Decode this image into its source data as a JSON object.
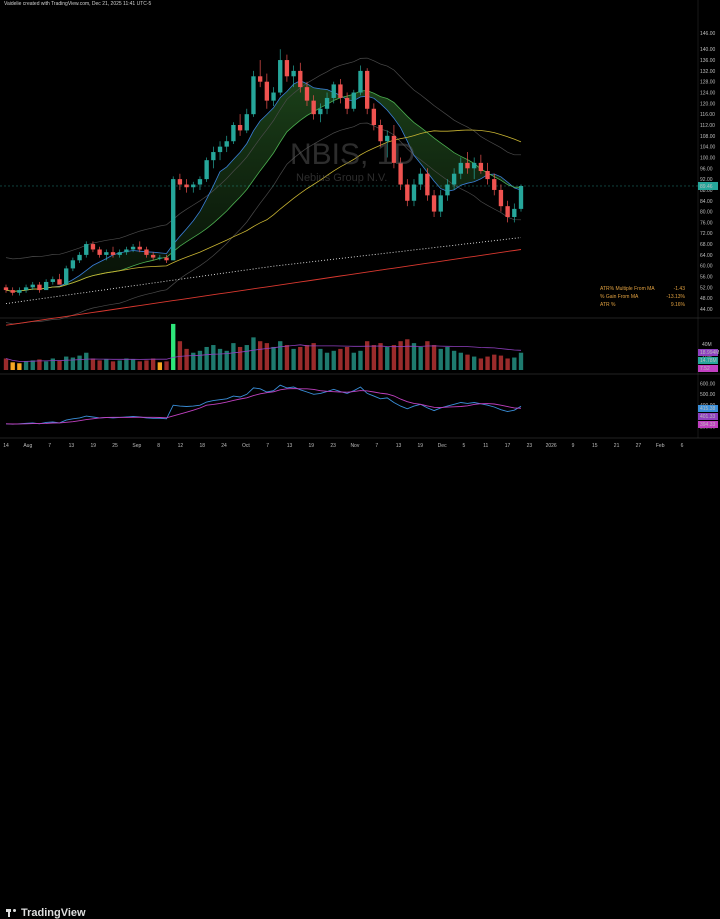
{
  "header": {
    "text": "Vaidelie created with TradingView.com, Dec 21, 2025 11:41 UTC-5"
  },
  "watermark": {
    "symbol": "NBIS, 1D",
    "name": "Nebius Group N.V."
  },
  "footer": {
    "logo_text": "TradingView"
  },
  "atr_table": [
    {
      "label": "ATR% Multiple From MA",
      "value": "-1.43"
    },
    {
      "label": "% Gain From MA",
      "value": "-13.13%"
    },
    {
      "label": "ATR %",
      "value": "9.16%"
    }
  ],
  "price_axis": [
    "146.00",
    "140.00",
    "136.00",
    "132.00",
    "128.00",
    "124.00",
    "120.00",
    "116.00",
    "112.00",
    "108.00",
    "104.00",
    "100.00",
    "96.00",
    "92.00",
    "88.00",
    "84.00",
    "80.00",
    "76.00",
    "72.00",
    "68.00",
    "64.00",
    "60.00",
    "56.00",
    "52.00",
    "48.00",
    "44.00"
  ],
  "price_badge": "89.46",
  "volume_axis": [
    "40M",
    "20M"
  ],
  "volume_badges": [
    "18.994M",
    "14.78M",
    "7.52"
  ],
  "osc_axis": [
    "600.00",
    "500.00",
    "400.00",
    "300.00",
    "200.00"
  ],
  "osc_badges": [
    "415.38",
    "401.33",
    "394.33"
  ],
  "time_axis": [
    "14",
    "Aug",
    "7",
    "13",
    "19",
    "25",
    "Sep",
    "8",
    "12",
    "18",
    "24",
    "Oct",
    "7",
    "13",
    "19",
    "23",
    "Nov",
    "7",
    "13",
    "19",
    "Dec",
    "5",
    "11",
    "17",
    "23",
    "2026",
    "9",
    "15",
    "21",
    "27",
    "Feb",
    "6"
  ],
  "colors": {
    "up": "#26a69a",
    "down": "#ef5350",
    "ma_yellow": "#c8b432",
    "ma_red": "#d9382f",
    "osc_line": "#3a8fd9",
    "osc_signal": "#c040c0",
    "vol_ma": "#9040c0",
    "pocket": "#2ee67a",
    "low_vol": "#f5a623"
  },
  "chart_data": {
    "type": "candlestick",
    "title": "NBIS, 1D",
    "subtitle": "Nebius Group N.V.",
    "ylim": [
      44,
      146
    ],
    "candles": [
      {
        "o": 52,
        "h": 53,
        "l": 50,
        "c": 51
      },
      {
        "o": 51,
        "h": 52,
        "l": 49,
        "c": 50
      },
      {
        "o": 50,
        "h": 52,
        "l": 49,
        "c": 51
      },
      {
        "o": 51,
        "h": 53,
        "l": 50,
        "c": 52
      },
      {
        "o": 52,
        "h": 54,
        "l": 51,
        "c": 53
      },
      {
        "o": 53,
        "h": 54,
        "l": 50,
        "c": 51
      },
      {
        "o": 51,
        "h": 55,
        "l": 51,
        "c": 54
      },
      {
        "o": 54,
        "h": 56,
        "l": 53,
        "c": 55
      },
      {
        "o": 55,
        "h": 57,
        "l": 54,
        "c": 53
      },
      {
        "o": 53,
        "h": 60,
        "l": 53,
        "c": 59
      },
      {
        "o": 59,
        "h": 63,
        "l": 58,
        "c": 62
      },
      {
        "o": 62,
        "h": 65,
        "l": 61,
        "c": 64
      },
      {
        "o": 64,
        "h": 69,
        "l": 63,
        "c": 68
      },
      {
        "o": 68,
        "h": 69,
        "l": 65,
        "c": 66
      },
      {
        "o": 66,
        "h": 67,
        "l": 63,
        "c": 64
      },
      {
        "o": 64,
        "h": 66,
        "l": 62,
        "c": 65
      },
      {
        "o": 65,
        "h": 67,
        "l": 63,
        "c": 64
      },
      {
        "o": 64,
        "h": 66,
        "l": 63,
        "c": 65
      },
      {
        "o": 65,
        "h": 67,
        "l": 64,
        "c": 66
      },
      {
        "o": 66,
        "h": 68,
        "l": 65,
        "c": 67
      },
      {
        "o": 67,
        "h": 69,
        "l": 65,
        "c": 66
      },
      {
        "o": 66,
        "h": 67,
        "l": 63,
        "c": 64
      },
      {
        "o": 64,
        "h": 65,
        "l": 62,
        "c": 63
      },
      {
        "o": 63,
        "h": 64,
        "l": 62,
        "c": 63
      },
      {
        "o": 63,
        "h": 64,
        "l": 61,
        "c": 62
      },
      {
        "o": 62,
        "h": 93,
        "l": 62,
        "c": 92
      },
      {
        "o": 92,
        "h": 94,
        "l": 88,
        "c": 90
      },
      {
        "o": 90,
        "h": 92,
        "l": 87,
        "c": 89
      },
      {
        "o": 89,
        "h": 91,
        "l": 87,
        "c": 90
      },
      {
        "o": 90,
        "h": 93,
        "l": 88,
        "c": 92
      },
      {
        "o": 92,
        "h": 100,
        "l": 91,
        "c": 99
      },
      {
        "o": 99,
        "h": 104,
        "l": 96,
        "c": 102
      },
      {
        "o": 102,
        "h": 106,
        "l": 99,
        "c": 104
      },
      {
        "o": 104,
        "h": 108,
        "l": 102,
        "c": 106
      },
      {
        "o": 106,
        "h": 113,
        "l": 105,
        "c": 112
      },
      {
        "o": 112,
        "h": 116,
        "l": 108,
        "c": 110
      },
      {
        "o": 110,
        "h": 118,
        "l": 109,
        "c": 116
      },
      {
        "o": 116,
        "h": 132,
        "l": 115,
        "c": 130
      },
      {
        "o": 130,
        "h": 136,
        "l": 126,
        "c": 128
      },
      {
        "o": 128,
        "h": 131,
        "l": 118,
        "c": 121
      },
      {
        "o": 121,
        "h": 126,
        "l": 119,
        "c": 124
      },
      {
        "o": 124,
        "h": 140,
        "l": 123,
        "c": 136
      },
      {
        "o": 136,
        "h": 138,
        "l": 128,
        "c": 130
      },
      {
        "o": 130,
        "h": 134,
        "l": 126,
        "c": 132
      },
      {
        "o": 132,
        "h": 135,
        "l": 124,
        "c": 126
      },
      {
        "o": 126,
        "h": 128,
        "l": 119,
        "c": 121
      },
      {
        "o": 121,
        "h": 123,
        "l": 114,
        "c": 116
      },
      {
        "o": 116,
        "h": 120,
        "l": 113,
        "c": 118
      },
      {
        "o": 118,
        "h": 124,
        "l": 116,
        "c": 122
      },
      {
        "o": 122,
        "h": 128,
        "l": 120,
        "c": 127
      },
      {
        "o": 127,
        "h": 129,
        "l": 120,
        "c": 122
      },
      {
        "o": 122,
        "h": 124,
        "l": 116,
        "c": 118
      },
      {
        "o": 118,
        "h": 125,
        "l": 117,
        "c": 124
      },
      {
        "o": 124,
        "h": 134,
        "l": 123,
        "c": 132
      },
      {
        "o": 132,
        "h": 133,
        "l": 116,
        "c": 118
      },
      {
        "o": 118,
        "h": 120,
        "l": 110,
        "c": 112
      },
      {
        "o": 112,
        "h": 114,
        "l": 104,
        "c": 106
      },
      {
        "o": 106,
        "h": 110,
        "l": 100,
        "c": 108
      },
      {
        "o": 108,
        "h": 112,
        "l": 96,
        "c": 98
      },
      {
        "o": 98,
        "h": 100,
        "l": 88,
        "c": 90
      },
      {
        "o": 90,
        "h": 92,
        "l": 82,
        "c": 84
      },
      {
        "o": 84,
        "h": 92,
        "l": 82,
        "c": 90
      },
      {
        "o": 90,
        "h": 96,
        "l": 88,
        "c": 94
      },
      {
        "o": 94,
        "h": 96,
        "l": 84,
        "c": 86
      },
      {
        "o": 86,
        "h": 88,
        "l": 78,
        "c": 80
      },
      {
        "o": 80,
        "h": 88,
        "l": 78,
        "c": 86
      },
      {
        "o": 86,
        "h": 92,
        "l": 84,
        "c": 90
      },
      {
        "o": 90,
        "h": 96,
        "l": 88,
        "c": 94
      },
      {
        "o": 94,
        "h": 100,
        "l": 92,
        "c": 98
      },
      {
        "o": 98,
        "h": 102,
        "l": 94,
        "c": 96
      },
      {
        "o": 96,
        "h": 100,
        "l": 92,
        "c": 98
      },
      {
        "o": 98,
        "h": 101,
        "l": 94,
        "c": 95
      },
      {
        "o": 95,
        "h": 98,
        "l": 90,
        "c": 92
      },
      {
        "o": 92,
        "h": 94,
        "l": 86,
        "c": 88
      },
      {
        "o": 88,
        "h": 90,
        "l": 80,
        "c": 82
      },
      {
        "o": 82,
        "h": 84,
        "l": 76,
        "c": 78
      },
      {
        "o": 78,
        "h": 83,
        "l": 76,
        "c": 81
      },
      {
        "o": 81,
        "h": 90,
        "l": 80,
        "c": 89.46
      }
    ],
    "volume_in_millions": [
      12,
      8,
      7,
      9,
      10,
      11,
      9,
      12,
      10,
      14,
      13,
      15,
      18,
      12,
      10,
      11,
      9,
      10,
      12,
      11,
      9,
      10,
      12,
      8,
      9,
      48,
      30,
      22,
      18,
      20,
      24,
      26,
      22,
      20,
      28,
      24,
      26,
      34,
      30,
      28,
      24,
      30,
      26,
      22,
      24,
      26,
      28,
      22,
      18,
      20,
      22,
      24,
      18,
      20,
      30,
      26,
      28,
      24,
      26,
      30,
      32,
      28,
      24,
      30,
      26,
      22,
      24,
      20,
      18,
      16,
      14,
      12,
      14,
      16,
      15,
      12,
      13,
      18
    ]
  }
}
